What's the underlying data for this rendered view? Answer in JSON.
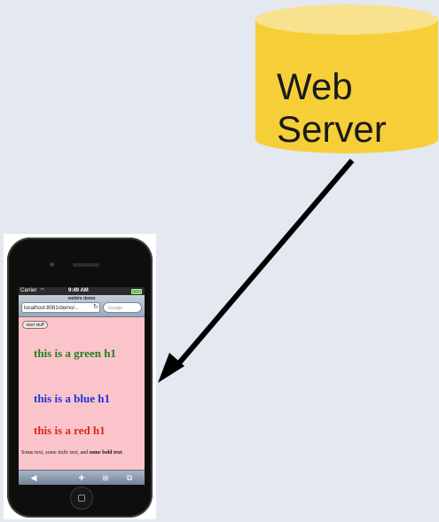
{
  "server": {
    "label_line1": "Web",
    "label_line2": "Server",
    "fill_color": "#f6cf38",
    "top_color": "#f9e28e"
  },
  "arrow": {
    "color": "#000000"
  },
  "phone": {
    "status": {
      "carrier": "Carrier",
      "wifi_icon": "wifi-icon",
      "time": "9:49 AM"
    },
    "browser": {
      "title": "webtre demo",
      "url": "localhost:8081/demo/...",
      "search_placeholder": "Google"
    },
    "page": {
      "background": "#fbc4ca",
      "start_button": "start stuff",
      "h1_green": "this is a green h1",
      "h1_blue": "this is a blue h1",
      "h1_red": "this is a red h1",
      "text_plain": "Some text, ",
      "text_italic": "some italic text",
      "text_mid": ", and ",
      "text_bold": "some bold text",
      "text_end": "."
    },
    "toolbar": {
      "back": "◀",
      "forward": "▶",
      "add": "+",
      "bookmarks": "📖",
      "tabs": "⧉"
    }
  }
}
